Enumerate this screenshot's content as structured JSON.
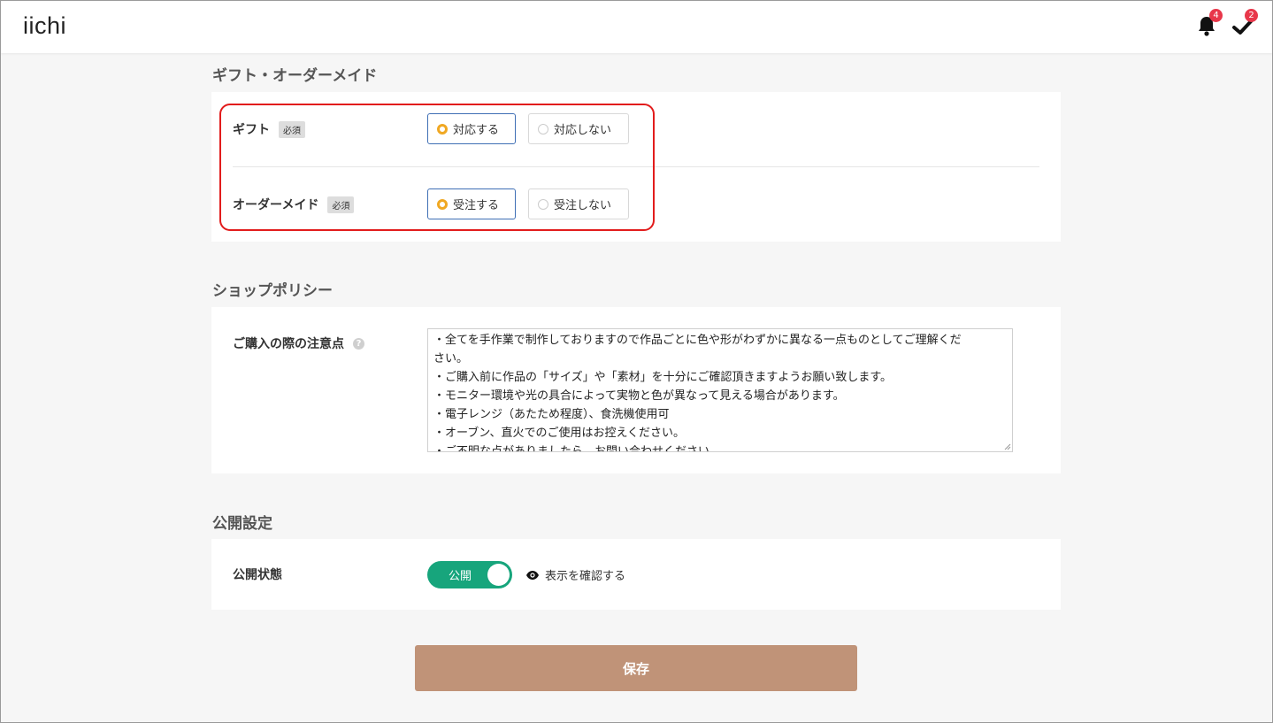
{
  "header": {
    "logo": "iichi",
    "notifications_count": "4",
    "tasks_count": "2"
  },
  "gift_section": {
    "title": "ギフト・オーダーメイド",
    "gift": {
      "label": "ギフト",
      "required": "必須",
      "options": [
        "対応する",
        "対応しない"
      ],
      "selected": "対応する"
    },
    "ordermade": {
      "label": "オーダーメイド",
      "required": "必須",
      "options": [
        "受注する",
        "受注しない"
      ],
      "selected": "受注する"
    }
  },
  "policy_section": {
    "title": "ショップポリシー",
    "notes_label": "ご購入の際の注意点",
    "help": "?",
    "notes_lines": [
      "・全てを手作業で制作しておりますので作品ごとに色や形がわずかに異なる一点ものとしてご理解くだ",
      "さい。",
      "・ご購入前に作品の「サイズ」や「素材」を十分にご確認頂きますようお願い致します。",
      "・モニター環境や光の具合によって実物と色が異なって見える場合があります。",
      "・電子レンジ（あたため程度）、食洗機使用可",
      "・オーブン、直火でのご使用はお控えください。",
      "・ご不明な点がありましたら、お問い合わせください。"
    ]
  },
  "publish_section": {
    "title": "公開設定",
    "status_label": "公開状態",
    "toggle_label": "公開",
    "toggle_on": true,
    "preview_link": "表示を確認する"
  },
  "save_button": "保存",
  "colors": {
    "accent_radio": "#f0a823",
    "selected_border": "#3f6fb5",
    "toggle_on": "#17a57c",
    "save_button": "#c09378",
    "highlight": "#e21c1c",
    "badge": "#e8374a"
  }
}
